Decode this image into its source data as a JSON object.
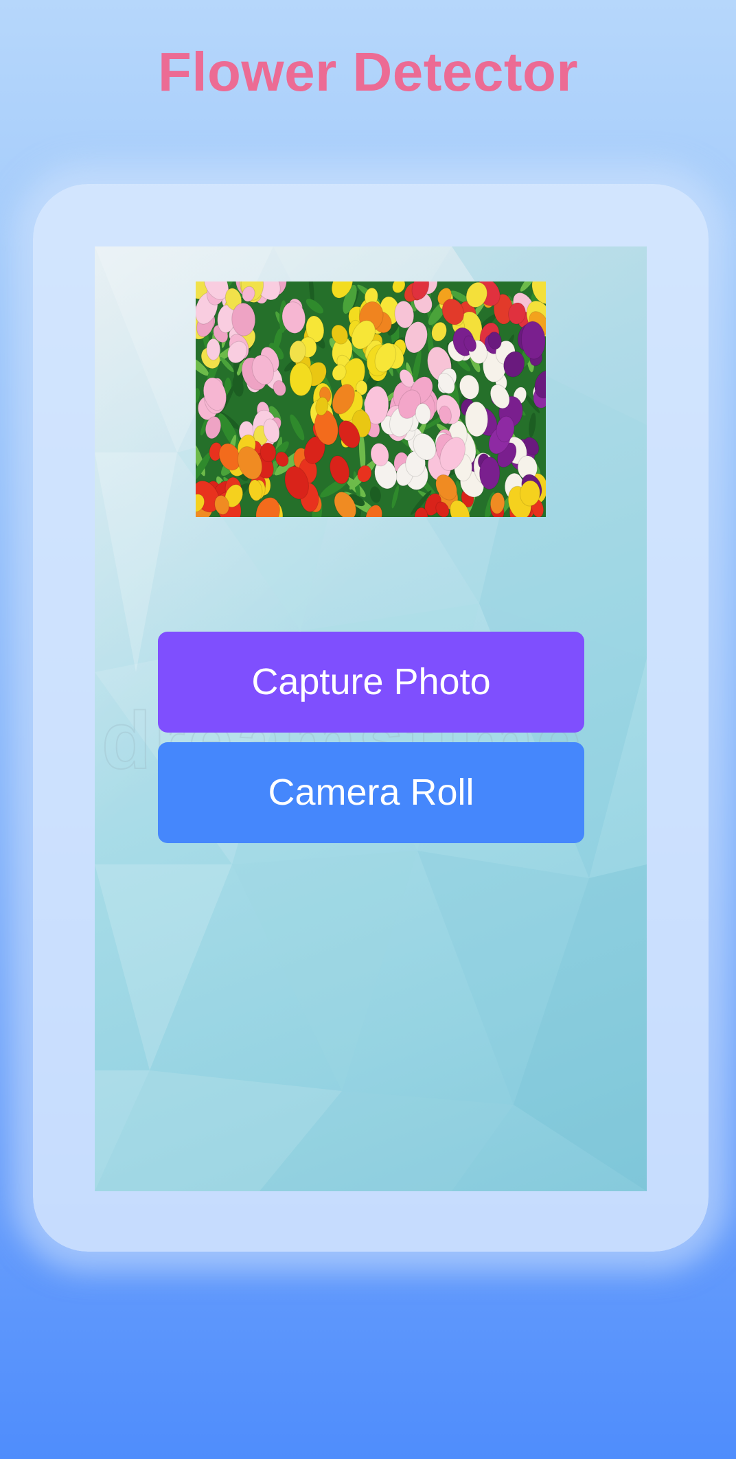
{
  "app": {
    "title": "Flower Detector"
  },
  "image": {
    "subject": "tulip-bouquet",
    "alt": ""
  },
  "watermark": {
    "text": "dreamstime"
  },
  "buttons": {
    "capture_label": "Capture Photo",
    "camera_roll_label": "Camera Roll"
  },
  "colors": {
    "title": "#ec6b94",
    "capture_button": "#7f4ffe",
    "camera_roll_button": "#4587fc",
    "button_text": "#ffffff"
  }
}
